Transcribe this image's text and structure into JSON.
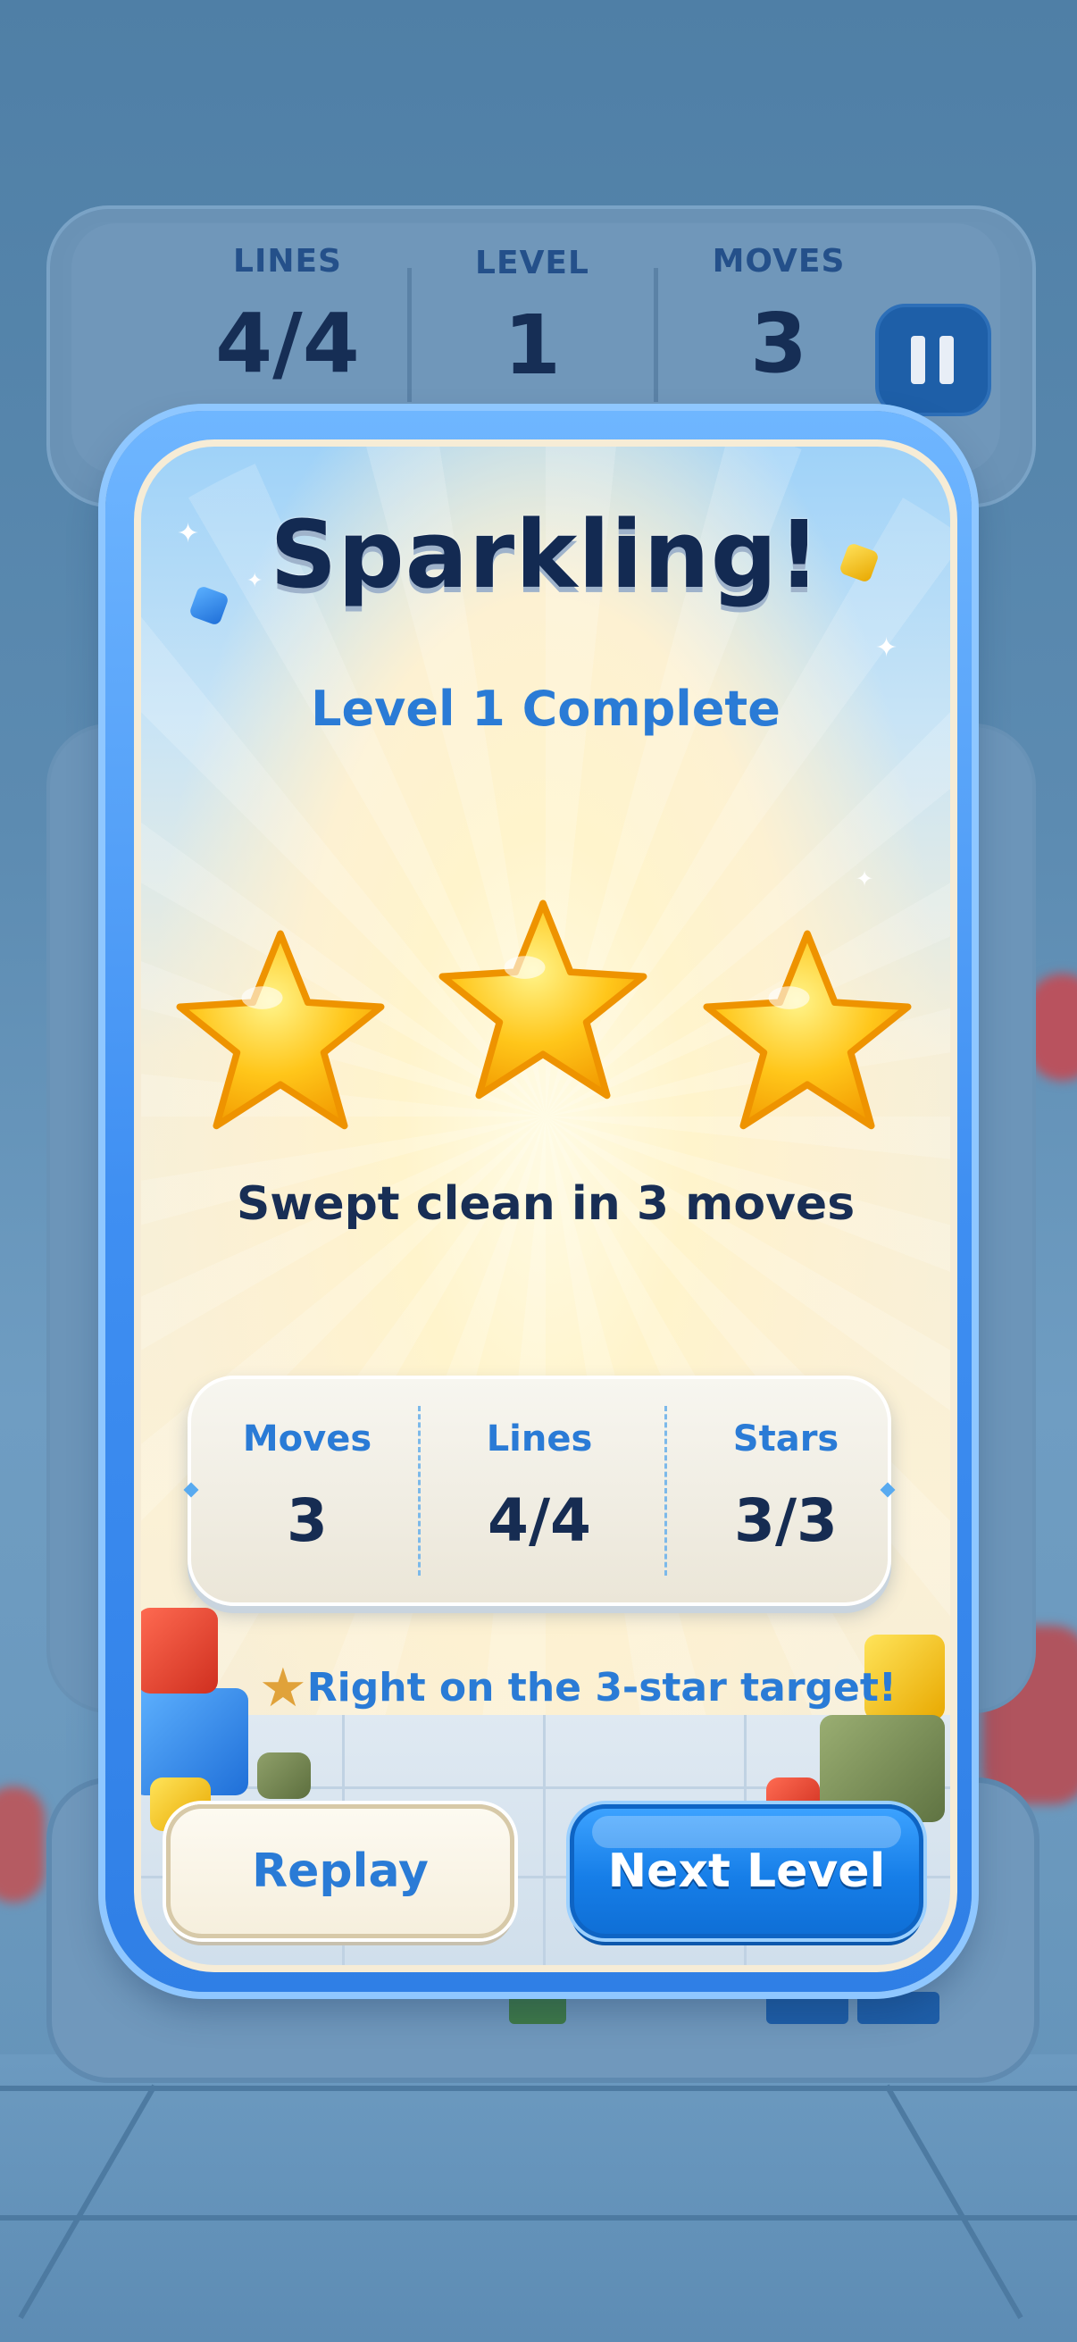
{
  "hud": {
    "lines_label": "LINES",
    "lines_value": "4/4",
    "level_label": "LEVEL",
    "level_value": "1",
    "moves_label": "MOVES",
    "moves_value": "3",
    "pause_icon": "pause-icon"
  },
  "modal": {
    "title": "Sparkling!",
    "subtitle": "Level 1 Complete",
    "stars_earned": 3,
    "stars_total": 3,
    "summary": "Swept clean in 3 moves",
    "stats": [
      {
        "label": "Moves",
        "value": "3"
      },
      {
        "label": "Lines",
        "value": "4/4"
      },
      {
        "label": "Stars",
        "value": "3/3"
      }
    ],
    "target_note": "Right on the 3-star target!",
    "target_icon": "star-icon",
    "replay_label": "Replay",
    "next_label": "Next Level"
  },
  "colors": {
    "accent_blue": "#2a7bd6",
    "title_navy": "#132a52",
    "star_gold": "#ffc21a",
    "next_button": "#167ee8"
  }
}
